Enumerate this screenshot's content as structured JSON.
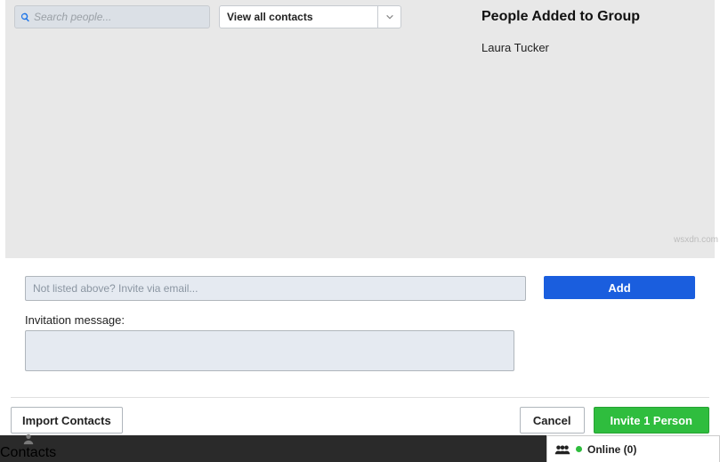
{
  "search": {
    "placeholder": "Search people..."
  },
  "viewSelect": {
    "label": "View all contacts"
  },
  "rightPanel": {
    "title": "People Added to Group",
    "people": [
      "Laura Tucker"
    ]
  },
  "emailInvite": {
    "placeholder": "Not listed above? Invite via email..."
  },
  "addButton": "Add",
  "messageLabel": "Invitation message:",
  "importButton": "Import Contacts",
  "cancelButton": "Cancel",
  "inviteButton": "Invite 1 Person",
  "footer": {
    "contactsTab": "Contacts"
  },
  "onlinePanel": {
    "text": "Online (0)"
  },
  "watermark": "wsxdn.com"
}
